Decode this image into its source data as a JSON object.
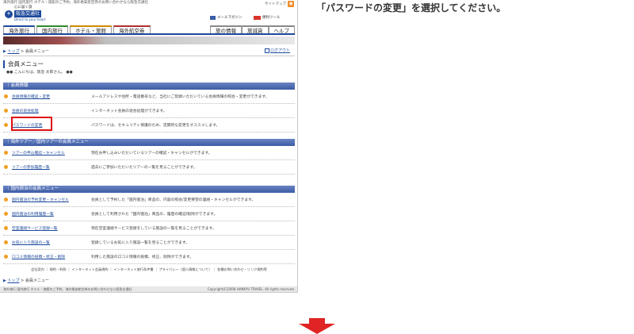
{
  "instruction": "「パスワードの変更」を選択してください。",
  "colors": {
    "brand": "#1e4a9b",
    "section_header": "#3d5ca6",
    "highlight": "#e01010",
    "arrow": "#e02424",
    "bullet": "#f0a020"
  },
  "top_bar": {
    "text": "海外旅行 国内旅行 ホテル・旅館のご予約、海外格安航空券のお問い合わせなら阪急交通社",
    "sitemap": "サイトマップ",
    "rss_icon": "rss-icon"
  },
  "logo": {
    "tagline": "心に届く旅",
    "name": "阪急交通社",
    "sub": "Direct to your heart"
  },
  "utility": {
    "magazine": "メールマガジン",
    "tools": "便利ツール"
  },
  "global_nav": {
    "tabs": [
      "海外旅行",
      "国内旅行",
      "ホテル・旅館",
      "海外航空券"
    ],
    "right_tabs": [
      "旅の情報",
      "旅減貨",
      "ヘルプ"
    ]
  },
  "breadcrumb": {
    "top": "トップ",
    "current": "会員メニュー",
    "sep": " > "
  },
  "logout": "ログアウト",
  "page_title": "会員メニュー",
  "greeting": "こんにちは、阪急 太郎さん。",
  "sections": [
    {
      "title": "会員情報",
      "items": [
        {
          "label": "会員情報の確認・変更",
          "desc": "メールアドレスや住所・電話番号など、当社にご登録いただいている会員情報の照会・変更ができます。"
        },
        {
          "label": "会員の退会処理",
          "desc": "インターネット会員の退会処理ができます。"
        },
        {
          "label": "パスワードの変更",
          "desc": "パスワードは、セキュリティ保護のため、定期的な変更をオススメします。"
        }
      ]
    },
    {
      "title": "海外ツアー／国内ツアーの会員メニュー",
      "items": [
        {
          "label": "ツアーの申込確認・キャンセル",
          "desc": "現在お申し込みいただいているツアーの確認・キャンセルができます。"
        },
        {
          "label": "ツアーの参加履歴一覧",
          "desc": "過去にご参加いただいたツアーの一覧を見ることができます。"
        }
      ]
    },
    {
      "title": "国内宿泊の会員メニュー",
      "items": [
        {
          "label": "国内宿泊の予約変更・キャンセル",
          "desc": "会員として予約した「国内宿泊」商品の、内容の照会/変更要望の連絡・キャンセルができます。"
        },
        {
          "label": "国内宿泊の利用履歴一覧",
          "desc": "会員として利用された「国内宿泊」商品の、履歴の確認/削除ができます。"
        },
        {
          "label": "空室連絡サービス登録一覧",
          "desc": "現在空室連絡サービス登録をしている施設の一覧を見ることができます。"
        },
        {
          "label": "お気に入り施設の一覧",
          "desc": "登録しているお気に入り施設一覧を見ることができます。"
        },
        {
          "label": "口コミ情報の投稿・修正・削除",
          "desc": "利用した施設の口コミ情報の投稿、修正、削除ができます。"
        }
      ]
    }
  ],
  "footer_links": "会社案内 ｜ 規約・約款 ｜ インターネット会員規約 ｜ インターネット旅行条件書 ｜ プライバシー（個人情報について） ｜ 各種お問い合わせ・リンク規約等",
  "footer": {
    "left": "海外旅行 国内旅行 ホテル・旅館のご予約、海外格安航空券のお問い合わせなら阪急交通社",
    "copyright": "Copyright(C)2008 HANKYU TRAVEL. All rights reserved."
  }
}
